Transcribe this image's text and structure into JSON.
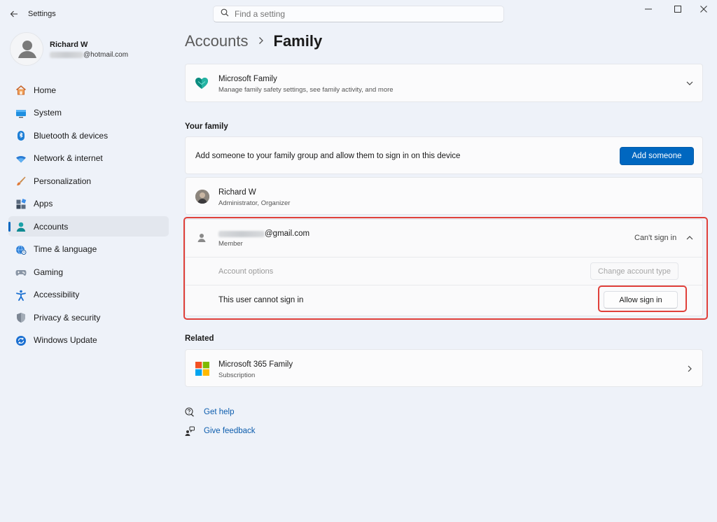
{
  "app": {
    "title": "Settings",
    "search_placeholder": "Find a setting"
  },
  "profile": {
    "name": "Richard W",
    "email_suffix": "@hotmail.com"
  },
  "nav": {
    "items": [
      {
        "label": "Home"
      },
      {
        "label": "System"
      },
      {
        "label": "Bluetooth & devices"
      },
      {
        "label": "Network & internet"
      },
      {
        "label": "Personalization"
      },
      {
        "label": "Apps"
      },
      {
        "label": "Accounts",
        "active": true
      },
      {
        "label": "Time & language"
      },
      {
        "label": "Gaming"
      },
      {
        "label": "Accessibility"
      },
      {
        "label": "Privacy & security"
      },
      {
        "label": "Windows Update"
      }
    ]
  },
  "breadcrumb": {
    "parent": "Accounts",
    "current": "Family"
  },
  "ms_family": {
    "title": "Microsoft Family",
    "subtitle": "Manage family safety settings, see family activity, and more"
  },
  "your_family": {
    "heading": "Your family",
    "add_text": "Add someone to your family group and allow them to sign in on this device",
    "add_button": "Add someone",
    "organizer": {
      "name": "Richard W",
      "role": "Administrator, Organizer"
    },
    "member": {
      "email_suffix": "@gmail.com",
      "role": "Member",
      "status": "Can't sign in",
      "account_options_label": "Account options",
      "change_type_button": "Change account type",
      "cannot_sign_in_text": "This user cannot sign in",
      "allow_button": "Allow sign in"
    }
  },
  "related": {
    "heading": "Related",
    "m365": {
      "title": "Microsoft 365 Family",
      "subtitle": "Subscription"
    }
  },
  "help": {
    "get_help": "Get help",
    "give_feedback": "Give feedback"
  },
  "colors": {
    "accent": "#0067c0",
    "highlight": "#e0403a",
    "background": "#eef2f9"
  }
}
